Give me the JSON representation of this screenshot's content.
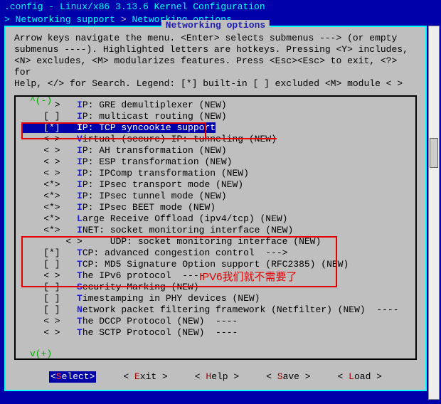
{
  "title": ".config - Linux/x86 3.13.6 Kernel Configuration",
  "breadcrumb_prefix": "> ",
  "breadcrumb_a": "Networking support",
  "breadcrumb_sep": " > ",
  "breadcrumb_b": "Networking options",
  "frame_title": "Networking options",
  "help1": "Arrow keys navigate the menu.  <Enter> selects submenus ---> (or empty",
  "help2": "submenus ----).  Highlighted letters are hotkeys.  Pressing <Y> includes,",
  "help3": "<N> excludes, <M> modularizes features.  Press <Esc><Esc> to exit, <?> for",
  "help4": "Help, </> for Search.  Legend: [*] built-in  [ ] excluded  <M> module  < >",
  "scroll_top": "^(-)",
  "scroll_bot": "v(+)",
  "items": [
    {
      "sel": "< >",
      "hk": "I",
      "rest": "P: GRE demultiplexer (NEW)"
    },
    {
      "sel": "[ ]",
      "hk": "I",
      "rest": "P: multicast routing (NEW)"
    },
    {
      "sel": "[*]",
      "hk": "I",
      "rest": "P: TCP syncookie support",
      "selected": true
    },
    {
      "sel": "< >",
      "hk": "V",
      "rest": "irtual (secure) IP: tunneling (NEW)",
      "strike": true
    },
    {
      "sel": "< >",
      "hk": "I",
      "rest": "P: AH transformation (NEW)"
    },
    {
      "sel": "< >",
      "hk": "I",
      "rest": "P: ESP transformation (NEW)"
    },
    {
      "sel": "< >",
      "hk": "I",
      "rest": "P: IPComp transformation (NEW)"
    },
    {
      "sel": "<*>",
      "hk": "I",
      "rest": "P: IPsec transport mode (NEW)"
    },
    {
      "sel": "<*>",
      "hk": "I",
      "rest": "P: IPsec tunnel mode (NEW)"
    },
    {
      "sel": "<*>",
      "hk": "I",
      "rest": "P: IPsec BEET mode (NEW)"
    },
    {
      "sel": "<*>",
      "hk": "L",
      "rest": "arge Receive Offload (ipv4/tcp) (NEW)"
    },
    {
      "sel": "<*>",
      "hk": "I",
      "rest": "NET: socket monitoring interface (NEW)"
    },
    {
      "sel": "< >",
      "hk": "",
      "rest": "  UDP: socket monitoring interface (NEW)",
      "indent": true
    },
    {
      "sel": "[*]",
      "hk": "T",
      "rest": "CP: advanced congestion control  --->"
    },
    {
      "sel": "[ ]",
      "hk": "T",
      "rest": "CP: MD5 Signature Option support (RFC2385) (NEW)"
    },
    {
      "sel": "< >",
      "hk": "T",
      "rest": "he IPv6 protocol  ----"
    },
    {
      "sel": "[ ]",
      "hk": "S",
      "rest": "ecurity Marking (NEW)"
    },
    {
      "sel": "[ ]",
      "hk": "T",
      "rest": "imestamping in PHY devices (NEW)"
    },
    {
      "sel": "[ ]",
      "hk": "N",
      "rest": "etwork packet filtering framework (Netfilter) (NEW)  ----"
    },
    {
      "sel": "< >",
      "hk": "T",
      "rest": "he DCCP Protocol (NEW)  ----"
    },
    {
      "sel": "< >",
      "hk": "T",
      "rest": "he SCTP Protocol (NEW)  ----"
    }
  ],
  "annotation": "IPV6我们就不需要了",
  "buttons": {
    "select": {
      "lt": "<",
      "hk": "S",
      "rest": "elect",
      "gt": ">"
    },
    "exit": {
      "lt": "< ",
      "hk": "E",
      "rest": "xit",
      " gt": " >"
    },
    "help": {
      "lt": "< ",
      "hk": "H",
      "rest": "elp",
      " gt": " >"
    },
    "save": {
      "lt": "< ",
      "hk": "S",
      "rest": "ave",
      " gt": " >"
    },
    "load": {
      "lt": "< ",
      "hk": "L",
      "rest": "oad",
      " gt": " >"
    }
  }
}
